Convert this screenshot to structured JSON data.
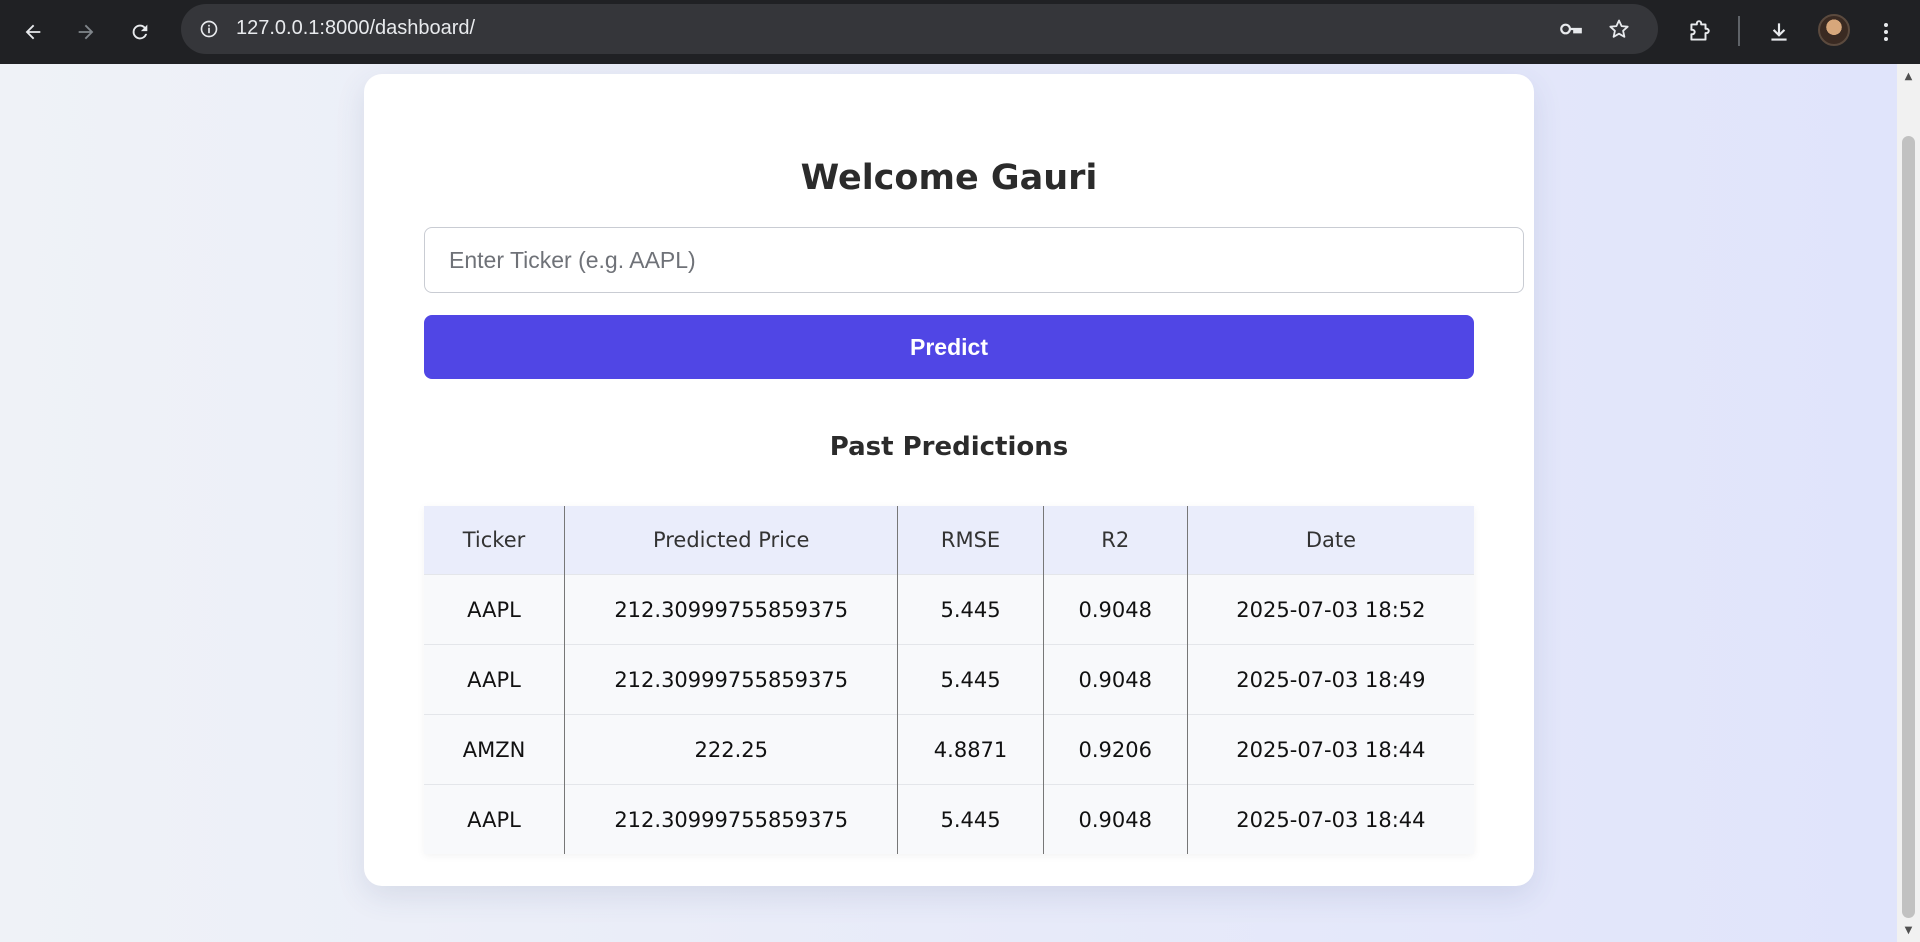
{
  "browser": {
    "url": "127.0.0.1:8000/dashboard/",
    "icons": {
      "back": "arrow-left-icon",
      "forward": "arrow-right-icon",
      "reload": "reload-icon",
      "site_info": "info-icon",
      "password": "key-icon",
      "bookmark": "star-icon",
      "extensions": "puzzle-icon",
      "downloads": "download-icon",
      "menu": "kebab-menu-icon"
    }
  },
  "page": {
    "welcome": "Welcome Gauri",
    "ticker_placeholder": "Enter Ticker (e.g. AAPL)",
    "predict_label": "Predict",
    "past_title": "Past Predictions",
    "accent_color": "#5046e5",
    "table": {
      "headers": [
        "Ticker",
        "Predicted Price",
        "RMSE",
        "R2",
        "Date"
      ],
      "rows": [
        [
          "AAPL",
          "212.30999755859375",
          "5.445",
          "0.9048",
          "2025-07-03 18:52"
        ],
        [
          "AAPL",
          "212.30999755859375",
          "5.445",
          "0.9048",
          "2025-07-03 18:49"
        ],
        [
          "AMZN",
          "222.25",
          "4.8871",
          "0.9206",
          "2025-07-03 18:44"
        ],
        [
          "AAPL",
          "212.30999755859375",
          "5.445",
          "0.9048",
          "2025-07-03 18:44"
        ]
      ]
    }
  }
}
